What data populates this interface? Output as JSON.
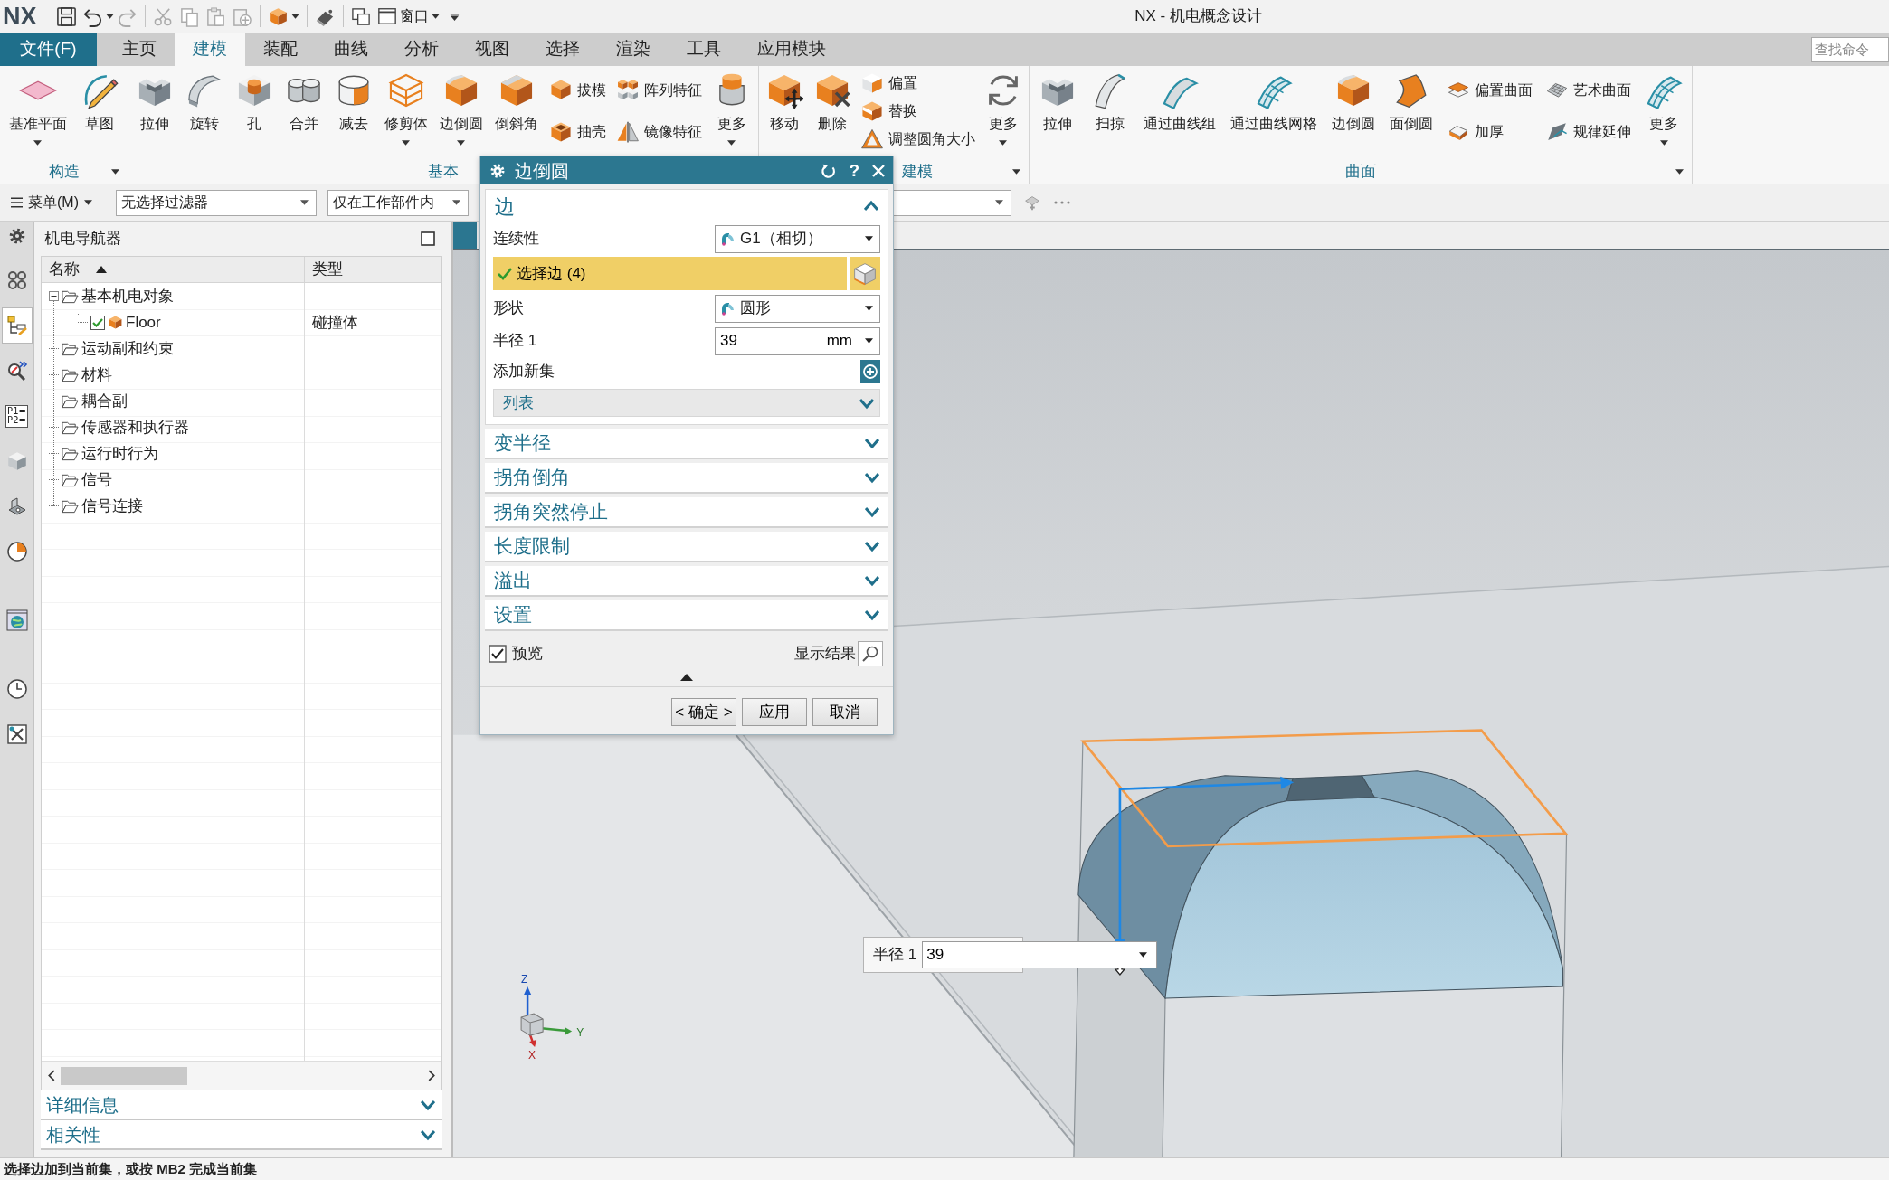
{
  "window": {
    "logo": "NX",
    "title": "NX - 机电概念设计"
  },
  "quick_access": {
    "window_menu": "窗口"
  },
  "ribbon_tabs": [
    {
      "label": "文件(F)",
      "kind": "file",
      "selected": false
    },
    {
      "label": "主页",
      "kind": "tab",
      "selected": false
    },
    {
      "label": "建模",
      "kind": "tab",
      "selected": true
    },
    {
      "label": "装配",
      "kind": "tab",
      "selected": false
    },
    {
      "label": "曲线",
      "kind": "tab",
      "selected": false
    },
    {
      "label": "分析",
      "kind": "tab",
      "selected": false
    },
    {
      "label": "视图",
      "kind": "tab",
      "selected": false
    },
    {
      "label": "选择",
      "kind": "tab",
      "selected": false
    },
    {
      "label": "渲染",
      "kind": "tab",
      "selected": false
    },
    {
      "label": "工具",
      "kind": "tab",
      "selected": false
    },
    {
      "label": "应用模块",
      "kind": "tab",
      "selected": false
    }
  ],
  "command_search": {
    "placeholder": "查找命令"
  },
  "ribbon_groups": [
    {
      "label": "构造",
      "menu": true,
      "items": [
        {
          "kind": "large",
          "label": "基准平面",
          "dropdown": true
        },
        {
          "kind": "large",
          "label": "草图"
        }
      ]
    },
    {
      "label": "基本",
      "items": [
        {
          "kind": "large",
          "label": "拉伸"
        },
        {
          "kind": "large",
          "label": "旋转"
        },
        {
          "kind": "large",
          "label": "孔"
        },
        {
          "kind": "large",
          "label": "合并"
        },
        {
          "kind": "large",
          "label": "减去"
        },
        {
          "kind": "large",
          "label": "修剪体",
          "dropdown": true
        },
        {
          "kind": "large",
          "label": "边倒圆",
          "dropdown": true
        },
        {
          "kind": "large",
          "label": "倒斜角"
        },
        {
          "kind": "stack",
          "items": [
            {
              "label": "拔模"
            },
            {
              "label": "抽壳"
            }
          ]
        },
        {
          "kind": "stack",
          "items": [
            {
              "label": "阵列特征"
            },
            {
              "label": "镜像特征"
            }
          ]
        },
        {
          "kind": "large",
          "label": "更多",
          "dropdown": true
        }
      ]
    },
    {
      "label": "建模",
      "menu": true,
      "items": [
        {
          "kind": "large",
          "label": "移动"
        },
        {
          "kind": "large",
          "label": "删除"
        },
        {
          "kind": "stack",
          "items": [
            {
              "label": "偏置"
            },
            {
              "label": "替换"
            },
            {
              "label": "调整圆角大小"
            }
          ]
        },
        {
          "kind": "large",
          "label": "更多",
          "dropdown": true
        }
      ]
    },
    {
      "label": "曲面",
      "menu": true,
      "items": [
        {
          "kind": "large",
          "label": "拉伸"
        },
        {
          "kind": "large",
          "label": "扫掠"
        },
        {
          "kind": "large",
          "label": "通过曲线组"
        },
        {
          "kind": "large",
          "label": "通过曲线网格"
        },
        {
          "kind": "large",
          "label": "边倒圆"
        },
        {
          "kind": "large",
          "label": "面倒圆"
        },
        {
          "kind": "stack",
          "items": [
            {
              "label": "偏置曲面"
            },
            {
              "label": "加厚"
            }
          ]
        },
        {
          "kind": "stack",
          "items": [
            {
              "label": "艺术曲面"
            },
            {
              "label": "规律延伸"
            }
          ]
        },
        {
          "kind": "large",
          "label": "更多",
          "dropdown": true
        }
      ]
    }
  ],
  "selection_bar": {
    "menu": "菜单(M)",
    "filters": [
      {
        "value": "无选择过滤器"
      },
      {
        "value": "仅在工作部件内"
      }
    ]
  },
  "resource_bar": {
    "tabs": [
      {
        "selected": false
      },
      {
        "selected": true
      },
      {
        "selected": false
      },
      {
        "selected": false,
        "lines": [
          "P1=",
          "P2="
        ]
      },
      {
        "selected": false
      },
      {
        "selected": false
      },
      {
        "selected": false
      },
      {
        "selected": false
      },
      {
        "selected": false
      },
      {
        "selected": false
      }
    ]
  },
  "navigator": {
    "title": "机电导航器",
    "columns": [
      {
        "label": "名称",
        "sort_ascending": true
      },
      {
        "label": "类型"
      }
    ],
    "tree": [
      {
        "name": "基本机电对象",
        "kind": "folder",
        "expanded": true,
        "children": [
          {
            "name": "Floor",
            "kind": "object",
            "type": "碰撞体",
            "checked": true
          }
        ]
      },
      {
        "name": "运动副和约束",
        "kind": "folder"
      },
      {
        "name": "材料",
        "kind": "folder"
      },
      {
        "name": "耦合副",
        "kind": "folder"
      },
      {
        "name": "传感器和执行器",
        "kind": "folder"
      },
      {
        "name": "运行时行为",
        "kind": "folder"
      },
      {
        "name": "信号",
        "kind": "folder"
      },
      {
        "name": "信号连接",
        "kind": "folder"
      }
    ],
    "panels": [
      {
        "label": "详细信息",
        "expanded": false
      },
      {
        "label": "相关性",
        "expanded": false
      }
    ]
  },
  "dialog": {
    "title": "边倒圆",
    "help": "?",
    "sections": [
      {
        "label": "边",
        "expanded": true,
        "rows": [
          {
            "kind": "dropdown",
            "label": "连续性",
            "value": "G1（相切）"
          },
          {
            "kind": "selector",
            "label": "选择边 (4)",
            "selected": true,
            "complete": true
          },
          {
            "kind": "dropdown",
            "label": "形状",
            "value": "圆形"
          },
          {
            "kind": "number",
            "label": "半径 1",
            "value": "39",
            "unit": "mm"
          },
          {
            "kind": "add",
            "label": "添加新集"
          },
          {
            "kind": "list",
            "label": "列表",
            "expanded": false
          }
        ]
      },
      {
        "label": "变半径",
        "expanded": false
      },
      {
        "label": "拐角倒角",
        "expanded": false
      },
      {
        "label": "拐角突然停止",
        "expanded": false
      },
      {
        "label": "长度限制",
        "expanded": false
      },
      {
        "label": "溢出",
        "expanded": false
      },
      {
        "label": "设置",
        "expanded": false
      }
    ],
    "preview": {
      "label": "预览",
      "checked": true
    },
    "show_result": {
      "label": "显示结果"
    },
    "buttons": [
      {
        "label": "< 确定 >"
      },
      {
        "label": "应用"
      },
      {
        "label": "取消"
      }
    ]
  },
  "graphics": {
    "radius_callout": {
      "label": "半径 1",
      "value": "39"
    },
    "triad": {
      "z": "Z",
      "y": "Y",
      "x": "X"
    }
  },
  "status_bar": {
    "message": "选择边加到当前集，或按 MB2 完成当前集"
  }
}
